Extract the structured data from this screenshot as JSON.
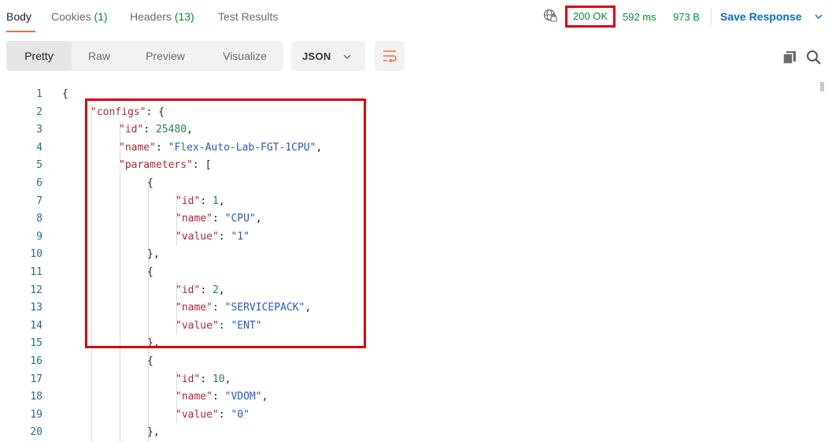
{
  "tabs": [
    {
      "label": "Body",
      "count": ""
    },
    {
      "label": "Cookies",
      "count": "(1)"
    },
    {
      "label": "Headers",
      "count": "(13)"
    },
    {
      "label": "Test Results",
      "count": ""
    }
  ],
  "status": {
    "code": "200 OK",
    "time": "592 ms",
    "size": "973 B"
  },
  "save_response_label": "Save Response",
  "view_modes": [
    "Pretty",
    "Raw",
    "Preview",
    "Visualize"
  ],
  "active_view_mode": "Pretty",
  "format_label": "JSON",
  "icons": {
    "globe": "globe-icon",
    "chevron": "chevron-down-icon",
    "wrap": "wrap-lines-icon",
    "copy": "copy-icon",
    "search": "search-icon"
  },
  "colors": {
    "accent": "#f26b3a",
    "success": "#0a8a3a",
    "link": "#0b6bcb",
    "highlight": "#d9000d"
  },
  "code_lines": [
    {
      "n": "1",
      "indent": 0,
      "tokens": [
        {
          "t": "p",
          "v": "{"
        }
      ]
    },
    {
      "n": "2",
      "indent": 1,
      "tokens": [
        {
          "t": "k",
          "v": "\"configs\""
        },
        {
          "t": "p",
          "v": ": {"
        }
      ]
    },
    {
      "n": "3",
      "indent": 2,
      "tokens": [
        {
          "t": "k",
          "v": "\"id\""
        },
        {
          "t": "p",
          "v": ": "
        },
        {
          "t": "n",
          "v": "25480"
        },
        {
          "t": "p",
          "v": ","
        }
      ]
    },
    {
      "n": "4",
      "indent": 2,
      "tokens": [
        {
          "t": "k",
          "v": "\"name\""
        },
        {
          "t": "p",
          "v": ": "
        },
        {
          "t": "s",
          "v": "\"Flex-Auto-Lab-FGT-1CPU\""
        },
        {
          "t": "p",
          "v": ","
        }
      ]
    },
    {
      "n": "5",
      "indent": 2,
      "tokens": [
        {
          "t": "k",
          "v": "\"parameters\""
        },
        {
          "t": "p",
          "v": ": ["
        }
      ]
    },
    {
      "n": "6",
      "indent": 3,
      "tokens": [
        {
          "t": "p",
          "v": "{"
        }
      ]
    },
    {
      "n": "7",
      "indent": 4,
      "tokens": [
        {
          "t": "k",
          "v": "\"id\""
        },
        {
          "t": "p",
          "v": ": "
        },
        {
          "t": "n",
          "v": "1"
        },
        {
          "t": "p",
          "v": ","
        }
      ]
    },
    {
      "n": "8",
      "indent": 4,
      "tokens": [
        {
          "t": "k",
          "v": "\"name\""
        },
        {
          "t": "p",
          "v": ": "
        },
        {
          "t": "s",
          "v": "\"CPU\""
        },
        {
          "t": "p",
          "v": ","
        }
      ]
    },
    {
      "n": "9",
      "indent": 4,
      "tokens": [
        {
          "t": "k",
          "v": "\"value\""
        },
        {
          "t": "p",
          "v": ": "
        },
        {
          "t": "s",
          "v": "\"1\""
        }
      ]
    },
    {
      "n": "10",
      "indent": 3,
      "tokens": [
        {
          "t": "p",
          "v": "},"
        }
      ]
    },
    {
      "n": "11",
      "indent": 3,
      "tokens": [
        {
          "t": "p",
          "v": "{"
        }
      ]
    },
    {
      "n": "12",
      "indent": 4,
      "tokens": [
        {
          "t": "k",
          "v": "\"id\""
        },
        {
          "t": "p",
          "v": ": "
        },
        {
          "t": "n",
          "v": "2"
        },
        {
          "t": "p",
          "v": ","
        }
      ]
    },
    {
      "n": "13",
      "indent": 4,
      "tokens": [
        {
          "t": "k",
          "v": "\"name\""
        },
        {
          "t": "p",
          "v": ": "
        },
        {
          "t": "s",
          "v": "\"SERVICEPACK\""
        },
        {
          "t": "p",
          "v": ","
        }
      ]
    },
    {
      "n": "14",
      "indent": 4,
      "tokens": [
        {
          "t": "k",
          "v": "\"value\""
        },
        {
          "t": "p",
          "v": ": "
        },
        {
          "t": "s",
          "v": "\"ENT\""
        }
      ]
    },
    {
      "n": "15",
      "indent": 3,
      "tokens": [
        {
          "t": "p",
          "v": "},"
        }
      ]
    },
    {
      "n": "16",
      "indent": 3,
      "tokens": [
        {
          "t": "p",
          "v": "{"
        }
      ]
    },
    {
      "n": "17",
      "indent": 4,
      "tokens": [
        {
          "t": "k",
          "v": "\"id\""
        },
        {
          "t": "p",
          "v": ": "
        },
        {
          "t": "n",
          "v": "10"
        },
        {
          "t": "p",
          "v": ","
        }
      ]
    },
    {
      "n": "18",
      "indent": 4,
      "tokens": [
        {
          "t": "k",
          "v": "\"name\""
        },
        {
          "t": "p",
          "v": ": "
        },
        {
          "t": "s",
          "v": "\"VDOM\""
        },
        {
          "t": "p",
          "v": ","
        }
      ]
    },
    {
      "n": "19",
      "indent": 4,
      "tokens": [
        {
          "t": "k",
          "v": "\"value\""
        },
        {
          "t": "p",
          "v": ": "
        },
        {
          "t": "s",
          "v": "\"0\""
        }
      ]
    },
    {
      "n": "20",
      "indent": 3,
      "tokens": [
        {
          "t": "p",
          "v": "},"
        }
      ]
    }
  ]
}
